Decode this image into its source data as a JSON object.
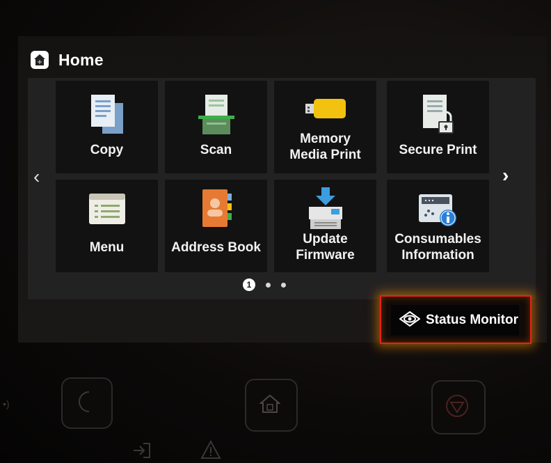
{
  "header": {
    "title": "Home",
    "icon": "home-icon"
  },
  "tiles": [
    {
      "label": "Copy",
      "icon": "copy-icon"
    },
    {
      "label": "Scan",
      "icon": "scan-icon"
    },
    {
      "label": "Memory\nMedia Print",
      "icon": "usb-memory-icon"
    },
    {
      "label": "Secure Print",
      "icon": "secure-print-icon"
    },
    {
      "label": "Menu",
      "icon": "menu-icon"
    },
    {
      "label": "Address Book",
      "icon": "address-book-icon"
    },
    {
      "label": "Update\nFirmware",
      "icon": "firmware-update-icon"
    },
    {
      "label": "Consumables\nInformation",
      "icon": "consumables-info-icon"
    }
  ],
  "pagination": {
    "current": "1",
    "pages": 3
  },
  "status_monitor": {
    "label": "Status Monitor",
    "icon": "eye-icon"
  },
  "hardware": {
    "energy_saver_icon": "moon-icon",
    "home_icon": "home-icon",
    "stop_icon": "stop-icon"
  },
  "colors": {
    "highlight_border": "#e52318",
    "glow": "#ff8c00",
    "tile_bg": "#121212"
  }
}
